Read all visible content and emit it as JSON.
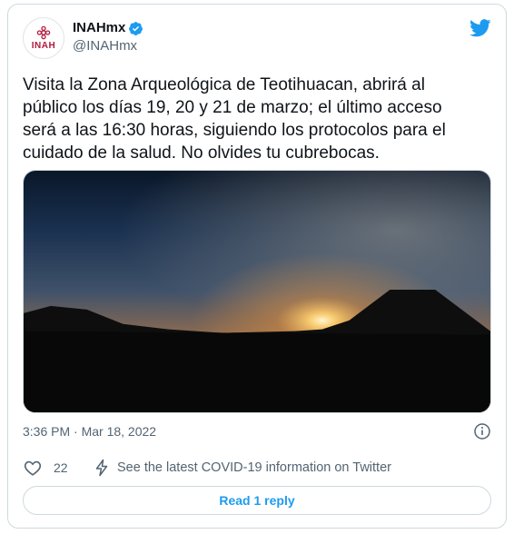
{
  "tweet": {
    "display_name": "INAHmx",
    "handle": "@INAHmx",
    "avatar_text": "INAH",
    "text": "Visita la Zona Arqueológica de Teotihuacan, abrirá al\npúblico los días 19, 20 y 21 de marzo; el último acceso\nserá a las 16:30 horas, siguiendo los protocolos para el\ncuidado de la salud. No olvides tu cubrebocas.",
    "timestamp": "3:36 PM · Mar 18, 2022",
    "likes": "22",
    "covid_link": "See the latest COVID-19 information on Twitter",
    "read_reply": "Read 1 reply"
  },
  "icons": {
    "brand": "twitter-bird-icon",
    "verified": "verified-badge-icon",
    "info": "info-icon",
    "like": "heart-icon",
    "covid": "bolt-icon"
  },
  "colors": {
    "accent": "#1d9bf0",
    "text": "#0f1419",
    "muted": "#536471",
    "border": "#cfd9de",
    "avatar_brand": "#b1183c"
  }
}
